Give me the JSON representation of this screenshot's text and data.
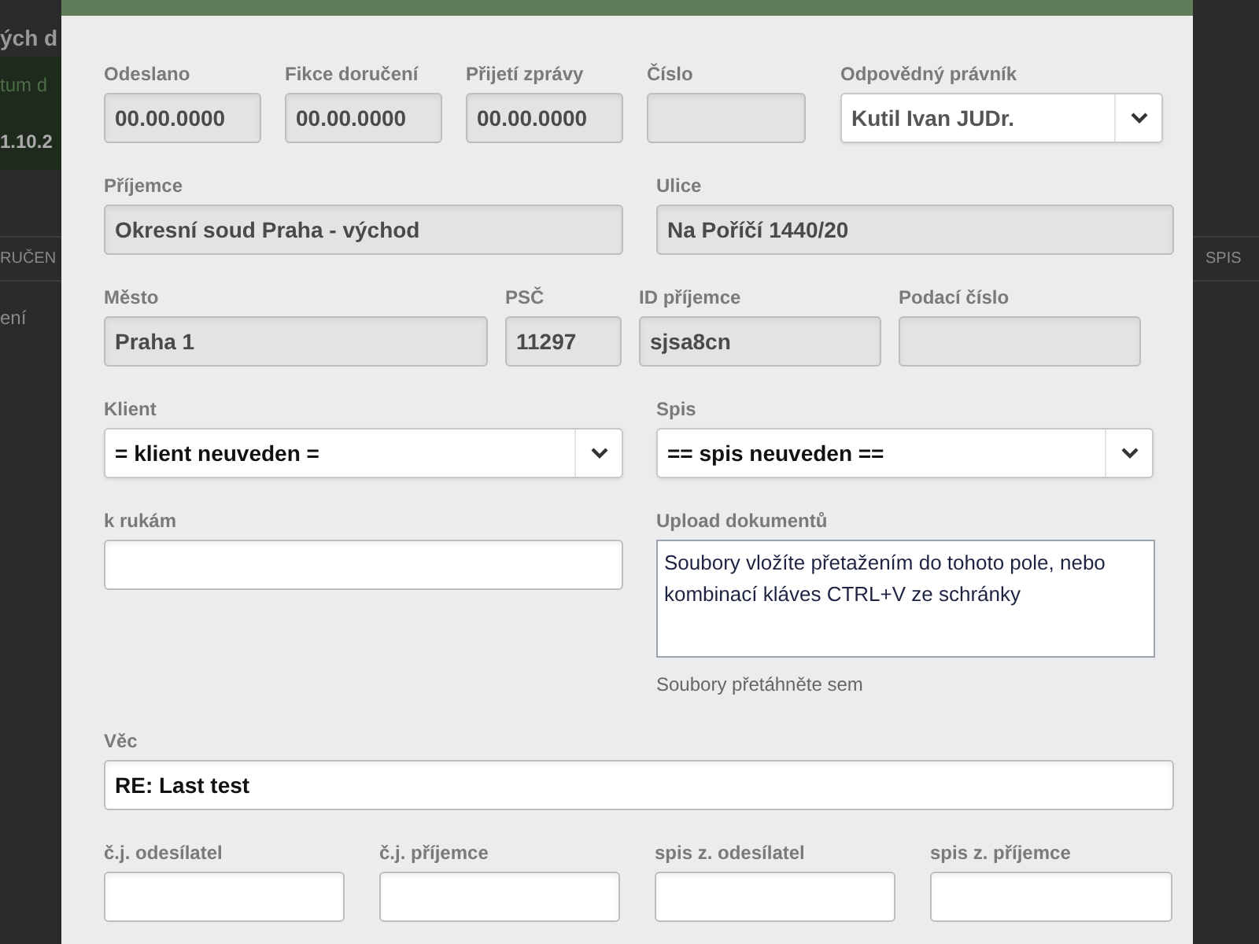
{
  "background": {
    "heading_fragment": "ých d",
    "filter_label": "tum d",
    "date_value": "1.10.2",
    "column_header_left": "RUČEN",
    "cell_left": "ení",
    "column_header_right": "SPIS"
  },
  "dialog": {
    "rows": [
      {
        "fields": [
          {
            "kind": "text",
            "label": "Odeslano",
            "value": "00.00.0000",
            "disabled": true
          },
          {
            "kind": "text",
            "label": "Fikce doručení",
            "value": "00.00.0000",
            "disabled": true
          },
          {
            "kind": "text",
            "label": "Přijetí zprávy",
            "value": "00.00.0000",
            "disabled": true
          },
          {
            "kind": "text",
            "label": "Číslo",
            "disabled": true
          },
          {
            "kind": "select",
            "label": "Odpovědný právník",
            "value": "Kutil Ivan JUDr.",
            "disabled": true
          }
        ]
      },
      {
        "fields": [
          {
            "kind": "text",
            "label": "Příjemce",
            "value": "Okresní soud Praha - východ",
            "disabled": true
          },
          {
            "kind": "text",
            "label": "Ulice",
            "value": "Na Poříčí 1440/20",
            "disabled": true
          }
        ]
      },
      {
        "fields": [
          {
            "kind": "text",
            "label": "Město",
            "value": "Praha 1",
            "disabled": true
          },
          {
            "kind": "text",
            "label": "PSČ",
            "value": "11297",
            "disabled": true
          },
          {
            "kind": "text",
            "label": "ID příjemce",
            "value": "sjsa8cn",
            "disabled": true
          },
          {
            "kind": "text",
            "label": "Podací číslo",
            "disabled": true
          }
        ]
      },
      {
        "fields": [
          {
            "kind": "select",
            "label": "Klient",
            "value": "= klient neuveden =",
            "disabled": false
          },
          {
            "kind": "select",
            "label": "Spis",
            "value": "== spis neuveden ==",
            "disabled": false
          }
        ]
      },
      {
        "fields": [
          {
            "kind": "text",
            "label": "k rukám",
            "disabled": false
          },
          {
            "kind": "upload",
            "label": "Upload dokumentů",
            "value": "Soubory vložíte přetažením do tohoto pole, nebo kombinací kláves CTRL+V ze schránky",
            "hint": "Soubory přetáhněte sem"
          }
        ]
      },
      {
        "fields": [
          {
            "kind": "text",
            "label": "Věc",
            "value": "RE: Last test",
            "disabled": false
          }
        ]
      },
      {
        "fields": [
          {
            "kind": "text",
            "label": "č.j. odesílatel",
            "disabled": false
          },
          {
            "kind": "text",
            "label": "č.j. příjemce",
            "disabled": false
          },
          {
            "kind": "text",
            "label": "spis z. odesílatel",
            "disabled": false
          },
          {
            "kind": "text",
            "label": "spis z. příjemce",
            "disabled": false
          }
        ]
      }
    ]
  }
}
